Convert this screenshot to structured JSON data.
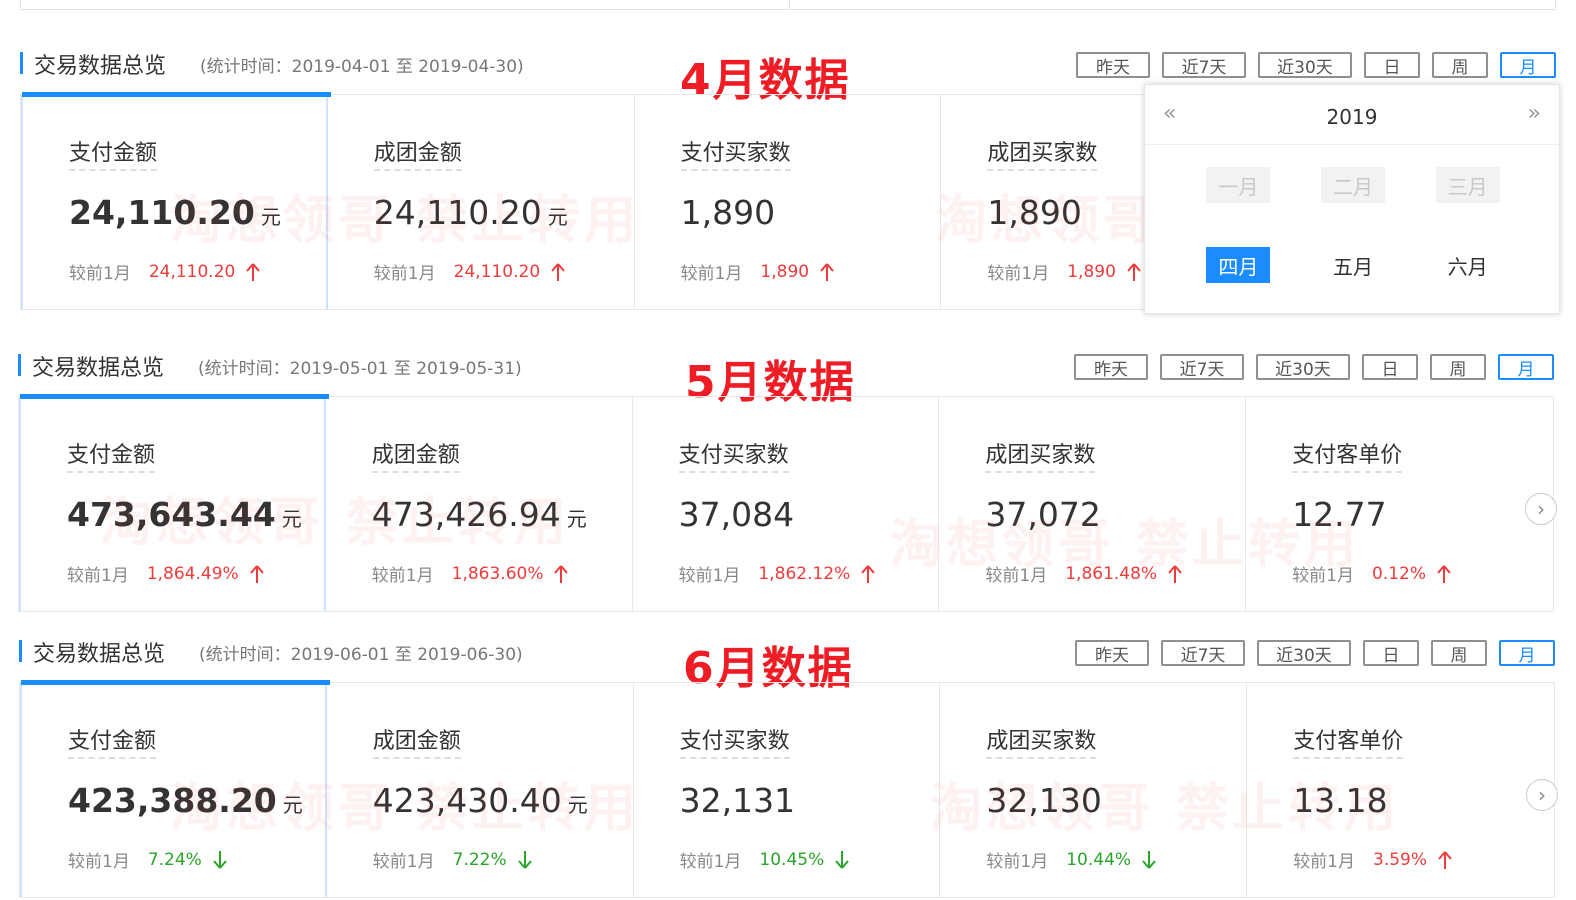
{
  "buttons": [
    "昨天",
    "近7天",
    "近30天",
    "日",
    "周",
    "月"
  ],
  "watermark": "淘想领哥 禁止转用",
  "sections": [
    {
      "title": "交易数据总览",
      "period": "(统计时间：2019-04-01 至 2019-04-30)",
      "big_label": "4月数据",
      "cards": [
        {
          "label": "支付金额",
          "value": "24,110.20",
          "unit": "元",
          "cmp_label": "较前1月",
          "cmp_value": "24,110.20",
          "trend": "up"
        },
        {
          "label": "成团金额",
          "value": "24,110.20",
          "unit": "元",
          "cmp_label": "较前1月",
          "cmp_value": "24,110.20",
          "trend": "up"
        },
        {
          "label": "支付买家数",
          "value": "1,890",
          "unit": "",
          "cmp_label": "较前1月",
          "cmp_value": "1,890",
          "trend": "up"
        },
        {
          "label": "成团买家数",
          "value": "1,890",
          "unit": "",
          "cmp_label": "较前1月",
          "cmp_value": "1,890",
          "trend": "up"
        }
      ]
    },
    {
      "title": "交易数据总览",
      "period": "(统计时间：2019-05-01 至 2019-05-31)",
      "big_label": "5月数据",
      "cards": [
        {
          "label": "支付金额",
          "value": "473,643.44",
          "unit": "元",
          "cmp_label": "较前1月",
          "cmp_value": "1,864.49%",
          "trend": "up"
        },
        {
          "label": "成团金额",
          "value": "473,426.94",
          "unit": "元",
          "cmp_label": "较前1月",
          "cmp_value": "1,863.60%",
          "trend": "up"
        },
        {
          "label": "支付买家数",
          "value": "37,084",
          "unit": "",
          "cmp_label": "较前1月",
          "cmp_value": "1,862.12%",
          "trend": "up"
        },
        {
          "label": "成团买家数",
          "value": "37,072",
          "unit": "",
          "cmp_label": "较前1月",
          "cmp_value": "1,861.48%",
          "trend": "up"
        },
        {
          "label": "支付客单价",
          "value": "12.77",
          "unit": "",
          "cmp_label": "较前1月",
          "cmp_value": "0.12%",
          "trend": "up"
        }
      ]
    },
    {
      "title": "交易数据总览",
      "period": "(统计时间：2019-06-01 至 2019-06-30)",
      "big_label": "6月数据",
      "cards": [
        {
          "label": "支付金额",
          "value": "423,388.20",
          "unit": "元",
          "cmp_label": "较前1月",
          "cmp_value": "7.24%",
          "trend": "down"
        },
        {
          "label": "成团金额",
          "value": "423,430.40",
          "unit": "元",
          "cmp_label": "较前1月",
          "cmp_value": "7.22%",
          "trend": "down"
        },
        {
          "label": "支付买家数",
          "value": "32,131",
          "unit": "",
          "cmp_label": "较前1月",
          "cmp_value": "10.45%",
          "trend": "down"
        },
        {
          "label": "成团买家数",
          "value": "32,130",
          "unit": "",
          "cmp_label": "较前1月",
          "cmp_value": "10.44%",
          "trend": "down"
        },
        {
          "label": "支付客单价",
          "value": "13.18",
          "unit": "",
          "cmp_label": "较前1月",
          "cmp_value": "3.59%",
          "trend": "up"
        }
      ]
    }
  ],
  "month_picker": {
    "prev": "«",
    "next": "»",
    "year": "2019",
    "months": [
      {
        "label": "一月",
        "state": "disabled"
      },
      {
        "label": "二月",
        "state": "disabled"
      },
      {
        "label": "三月",
        "state": "disabled"
      },
      {
        "label": "四月",
        "state": "current"
      },
      {
        "label": "五月",
        "state": "normal"
      },
      {
        "label": "六月",
        "state": "normal"
      }
    ]
  },
  "next_icon": "chevron-right-icon",
  "colors": {
    "accent": "#1a8cff",
    "up": "#ee3b3b",
    "down": "#2aa42a",
    "highlight": "#ee1c24"
  }
}
